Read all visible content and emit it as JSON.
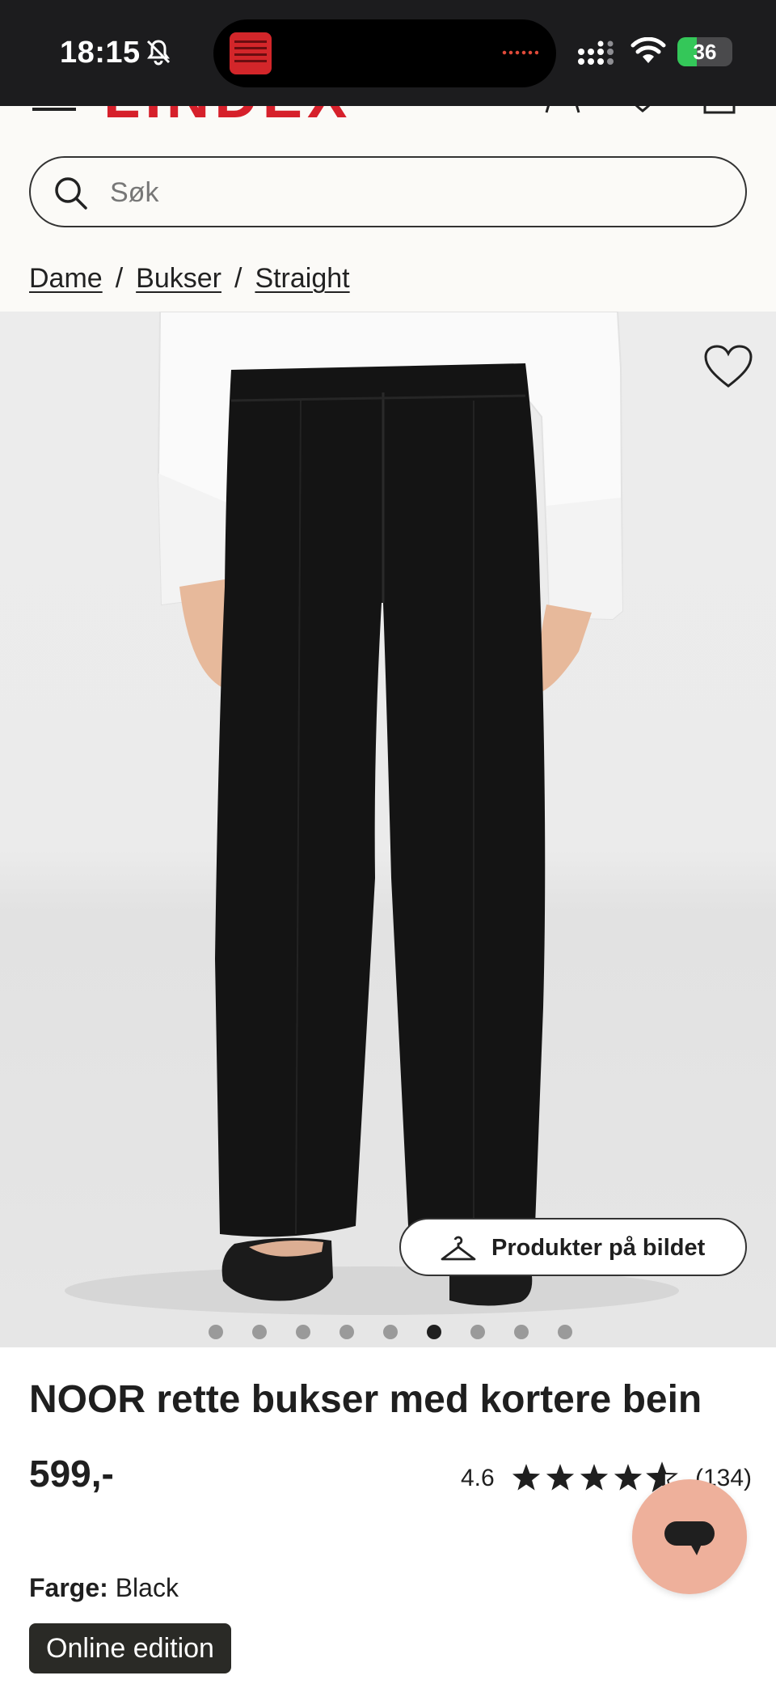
{
  "status_bar": {
    "time": "18:15",
    "battery": "36",
    "battery_level": 0.36,
    "icons": [
      "bell-muted-icon",
      "signal-icon",
      "wifi-icon",
      "battery-icon"
    ]
  },
  "header": {
    "logo": "LINDEX",
    "brand_color": "#d6202b",
    "icons": [
      "menu-icon",
      "account-icon",
      "wishlist-icon",
      "bag-icon"
    ]
  },
  "search": {
    "placeholder": "Søk"
  },
  "breadcrumb": [
    {
      "label": "Dame"
    },
    {
      "label": "Bukser"
    },
    {
      "label": "Straight"
    }
  ],
  "gallery": {
    "products_button_label": "Produkter på bildet",
    "dot_count": 9,
    "active_index": 5
  },
  "product": {
    "title": "NOOR rette bukser med kortere bein",
    "price": "599,-",
    "rating": "4.6",
    "rating_value": 4.6,
    "rating_count": "(134)",
    "color_label": "Farge:",
    "color_value": "Black",
    "edition_badge": "Online edition"
  },
  "chat": {
    "button_color": "#eeb09b",
    "icon": "chat-bubble-icon"
  }
}
